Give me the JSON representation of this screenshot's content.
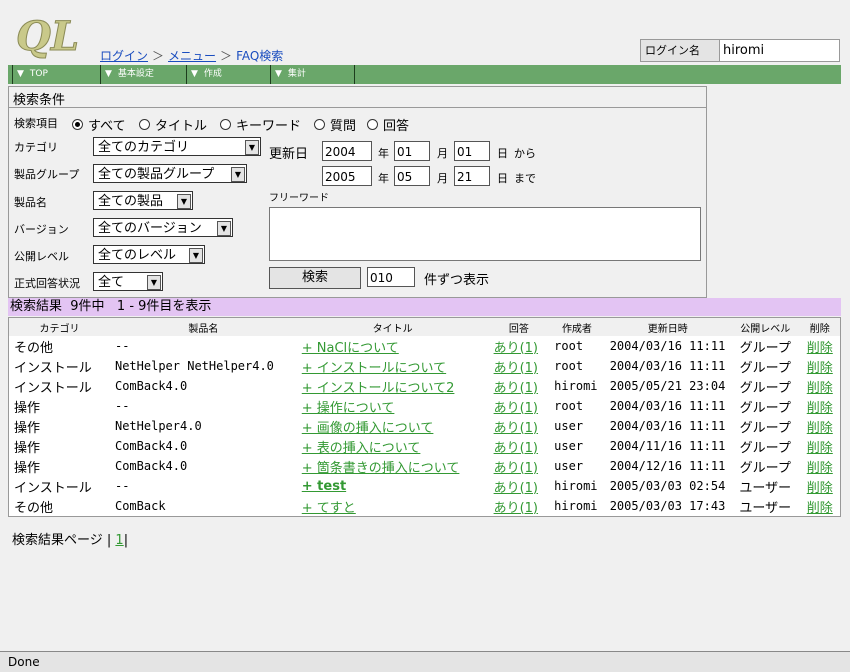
{
  "logo": {
    "text": "QL"
  },
  "breadcrumb": {
    "login": "ログイン",
    "menu": "メニュー",
    "current": "FAQ検索",
    "sep": "＞"
  },
  "login": {
    "label": "ログイン名",
    "value": "hiromi"
  },
  "nav": [
    {
      "label": "TOP"
    },
    {
      "label": "基本設定"
    },
    {
      "label": "作成"
    },
    {
      "label": "集計"
    }
  ],
  "search": {
    "title": "検索条件",
    "field_label": "検索項目",
    "fields": [
      "すべて",
      "タイトル",
      "キーワード",
      "質問",
      "回答"
    ],
    "category_label": "カテゴリ",
    "category_value": "全てのカテゴリ",
    "group_label": "製品グループ",
    "group_value": "全ての製品グループ",
    "product_label": "製品名",
    "product_value": "全ての製品",
    "version_label": "バージョン",
    "version_value": "全てのバージョン",
    "public_label": "公開レベル",
    "public_value": "全てのレベル",
    "answer_label": "正式回答状況",
    "answer_value": "全て",
    "update_label": "更新日",
    "from": {
      "year": "2004",
      "month": "01",
      "day": "01"
    },
    "to": {
      "year": "2005",
      "month": "05",
      "day": "21"
    },
    "year_unit": "年",
    "month_unit": "月",
    "day_unit": "日",
    "from_suffix": "から",
    "to_suffix": "まで",
    "freeword_label": "フリーワード",
    "button": "検索",
    "per_page": "010",
    "per_page_suffix": "件ずつ表示"
  },
  "result": {
    "summary": "検索結果  9件中   1 - 9件目を表示",
    "headers": [
      "カテゴリ",
      "製品名",
      "タイトル",
      "回答",
      "作成者",
      "更新日時",
      "公開レベル",
      "削除"
    ],
    "rows": [
      {
        "category": "その他",
        "product": "--",
        "title": "+ NaClについて",
        "answer": "あり(1)",
        "author": "root",
        "updated": "2004/03/16 11:11",
        "level": "グループ",
        "delete": "削除",
        "bold": false
      },
      {
        "category": "インストール",
        "product": "NetHelper NetHelper4.0",
        "title": "+ インストールについて",
        "answer": "あり(1)",
        "author": "root",
        "updated": "2004/03/16 11:11",
        "level": "グループ",
        "delete": "削除",
        "bold": false
      },
      {
        "category": "インストール",
        "product": "ComBack4.0",
        "title": "+ インストールについて2",
        "answer": "あり(1)",
        "author": "hiromi",
        "updated": "2005/05/21 23:04",
        "level": "グループ",
        "delete": "削除",
        "bold": false
      },
      {
        "category": "操作",
        "product": "--",
        "title": "+ 操作について",
        "answer": "あり(1)",
        "author": "root",
        "updated": "2004/03/16 11:11",
        "level": "グループ",
        "delete": "削除",
        "bold": false
      },
      {
        "category": "操作",
        "product": "NetHelper4.0",
        "title": "+ 画像の挿入について",
        "answer": "あり(1)",
        "author": "user",
        "updated": "2004/03/16 11:11",
        "level": "グループ",
        "delete": "削除",
        "bold": false
      },
      {
        "category": "操作",
        "product": "ComBack4.0",
        "title": "+ 表の挿入について",
        "answer": "あり(1)",
        "author": "user",
        "updated": "2004/11/16 11:11",
        "level": "グループ",
        "delete": "削除",
        "bold": false
      },
      {
        "category": "操作",
        "product": "ComBack4.0",
        "title": "+ 箇条書きの挿入について",
        "answer": "あり(1)",
        "author": "user",
        "updated": "2004/12/16 11:11",
        "level": "グループ",
        "delete": "削除",
        "bold": false
      },
      {
        "category": "インストール",
        "product": "--",
        "title": "+ test",
        "answer": "あり(1)",
        "author": "hiromi",
        "updated": "2005/03/03 02:54",
        "level": "ユーザー",
        "delete": "削除",
        "bold": true
      },
      {
        "category": "その他",
        "product": "ComBack",
        "title": "+ てすと",
        "answer": "あり(1)",
        "author": "hiromi",
        "updated": "2005/03/03 17:43",
        "level": "ユーザー",
        "delete": "削除",
        "bold": false
      }
    ]
  },
  "pager": {
    "label": "検索結果ページ",
    "page": "1"
  },
  "status": "Done",
  "colors": {
    "nav_bg": "#6aa76a",
    "result_bar": "#e3c4f3",
    "link": "#339933",
    "breadcrumb_link": "#1a4dbf"
  }
}
